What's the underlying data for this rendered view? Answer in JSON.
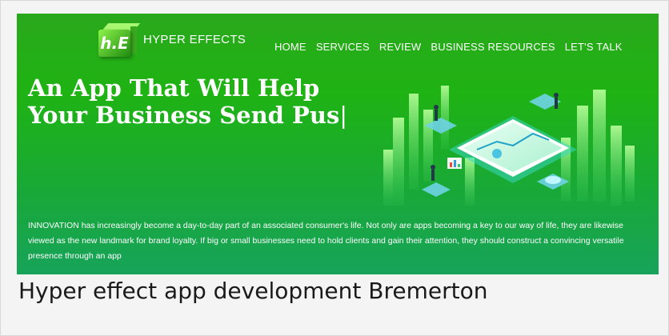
{
  "logo": {
    "mark": "h.E",
    "name": "HYPER EFFECTS"
  },
  "nav": {
    "items": [
      {
        "label": "HOME"
      },
      {
        "label": "SERVICES"
      },
      {
        "label": "REVIEW"
      },
      {
        "label": "BUSINESS RESOURCES"
      },
      {
        "label": "LET'S TALK"
      }
    ]
  },
  "hero": {
    "line1": "An App That Will Help",
    "line2": "Your Business Send Pus",
    "cursor": "|",
    "description": "INNOVATION has increasingly become a day-to-day part of an associated consumer's life. Not only are apps becoming a key to our way of life, they are likewise viewed as the new landmark for brand loyalty. If big or small businesses need to hold clients and gain their attention, they should construct a convincing versatile presence through an app",
    "illustration_icon": "isometric-app-city-icon"
  },
  "caption": "Hyper effect app development Bremerton",
  "colors": {
    "banner_top": "#2aa81c",
    "banner_bottom": "#17a35a",
    "text": "#ffffff"
  }
}
